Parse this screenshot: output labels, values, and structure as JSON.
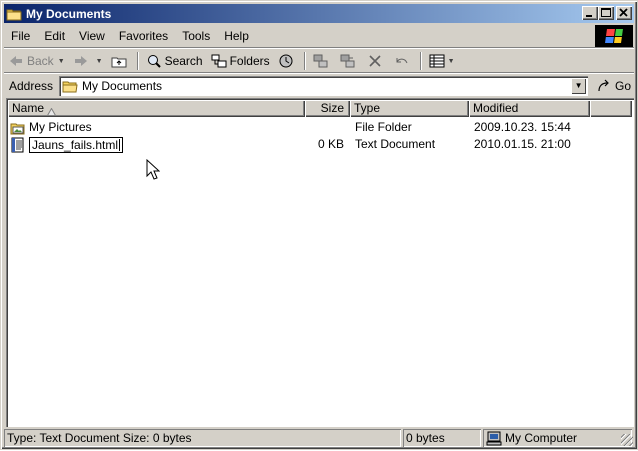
{
  "window": {
    "title": "My Documents"
  },
  "title_buttons": {
    "minimize": "_",
    "maximize": "□",
    "close": "×"
  },
  "menu": [
    "File",
    "Edit",
    "View",
    "Favorites",
    "Tools",
    "Help"
  ],
  "toolbar": {
    "back_label": "Back",
    "search_label": "Search",
    "folders_label": "Folders"
  },
  "address": {
    "label": "Address",
    "value": "My Documents",
    "go_label": "Go"
  },
  "columns": {
    "name": "Name",
    "size": "Size",
    "type": "Type",
    "modified": "Modified"
  },
  "files": [
    {
      "name": "My Pictures",
      "size": "",
      "type": "File Folder",
      "modified": "2009.10.23. 15:44",
      "icon": "pictures-folder-icon"
    },
    {
      "name": "Jauns_fails.html",
      "size": "0 KB",
      "type": "Text Document",
      "modified": "2010.01.15. 21:00",
      "icon": "text-document-icon",
      "renaming": true
    }
  ],
  "status": {
    "info": "Type: Text Document Size: 0 bytes",
    "size": "0 bytes",
    "location": "My Computer"
  },
  "colors": {
    "title_start": "#0a246a",
    "title_end": "#a6caf0",
    "face": "#d4d0c8"
  }
}
